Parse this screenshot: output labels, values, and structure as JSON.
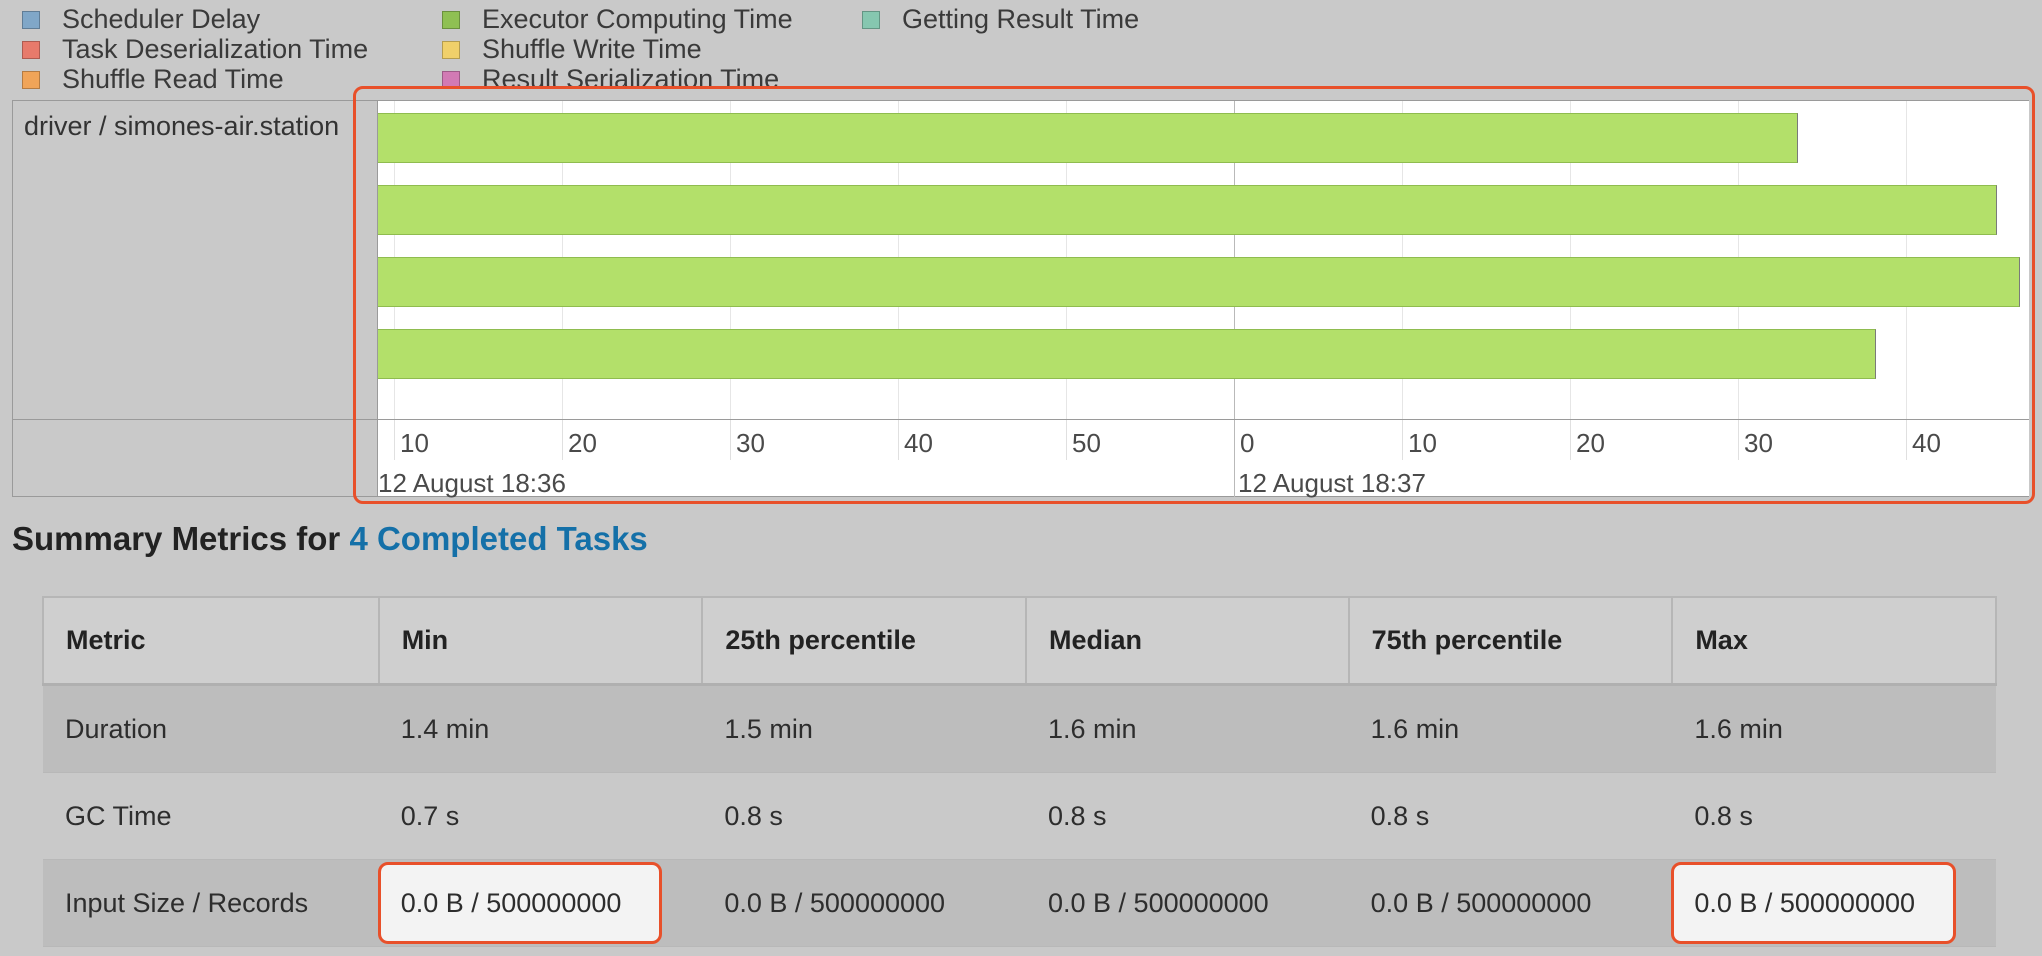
{
  "legend": [
    {
      "label": "Scheduler Delay",
      "color": "#80a7c8"
    },
    {
      "label": "Task Deserialization Time",
      "color": "#e77a6b"
    },
    {
      "label": "Shuffle Read Time",
      "color": "#f0a458"
    },
    {
      "label": "Executor Computing Time",
      "color": "#8fc053"
    },
    {
      "label": "Shuffle Write Time",
      "color": "#f0d06a"
    },
    {
      "label": "Result Serialization Time",
      "color": "#d27ab4"
    },
    {
      "label": "Getting Result Time",
      "color": "#86c7b0"
    }
  ],
  "timeline": {
    "group_label": "driver / simones-air.station",
    "ticks": [
      "10",
      "20",
      "30",
      "40",
      "50",
      "0",
      "10",
      "20",
      "30",
      "40"
    ],
    "major_labels": [
      "12 August 18:36",
      "12 August 18:37"
    ],
    "bar_color": "#b3e06a",
    "tasks": [
      {
        "start_s": 8.8,
        "end_s": 93.6
      },
      {
        "start_s": 8.8,
        "end_s": 105.4
      },
      {
        "start_s": 8.8,
        "end_s": 106.8
      },
      {
        "start_s": 8.8,
        "end_s": 98.2
      }
    ]
  },
  "summary": {
    "heading_prefix": "Summary Metrics for ",
    "heading_link": "4 Completed Tasks",
    "columns": [
      "Metric",
      "Min",
      "25th percentile",
      "Median",
      "75th percentile",
      "Max"
    ],
    "rows": [
      [
        "Duration",
        "1.4 min",
        "1.5 min",
        "1.6 min",
        "1.6 min",
        "1.6 min"
      ],
      [
        "GC Time",
        "0.7 s",
        "0.8 s",
        "0.8 s",
        "0.8 s",
        "0.8 s"
      ],
      [
        "Input Size / Records",
        "0.0 B / 500000000",
        "0.0 B / 500000000",
        "0.0 B / 500000000",
        "0.0 B / 500000000",
        "0.0 B / 500000000"
      ]
    ]
  }
}
